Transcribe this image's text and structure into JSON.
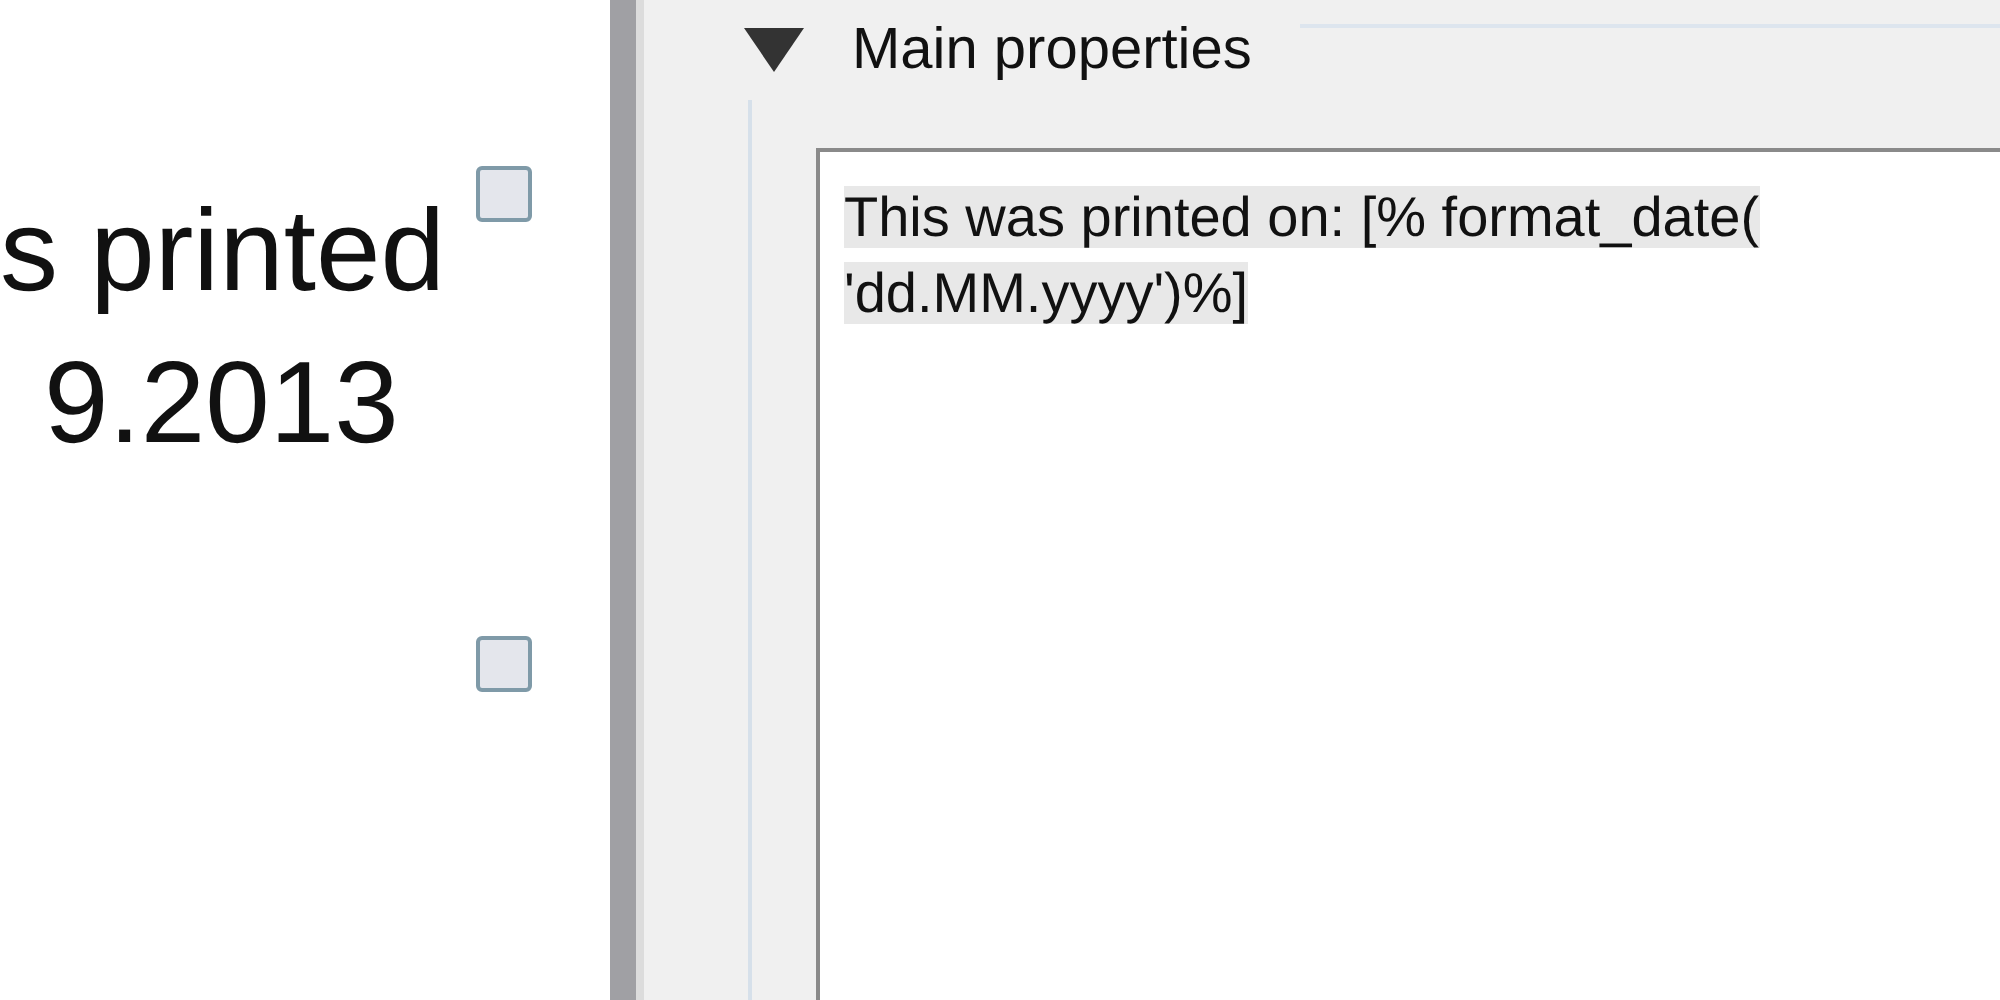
{
  "canvas": {
    "label_lines": [
      "s printed",
      "9.2013"
    ]
  },
  "properties_panel": {
    "group": {
      "title": "Main properties",
      "expanded": true
    },
    "label_text": {
      "lines": [
        "This was printed on: [% format_date(",
        "'dd.MM.yyyy')%]"
      ]
    }
  }
}
